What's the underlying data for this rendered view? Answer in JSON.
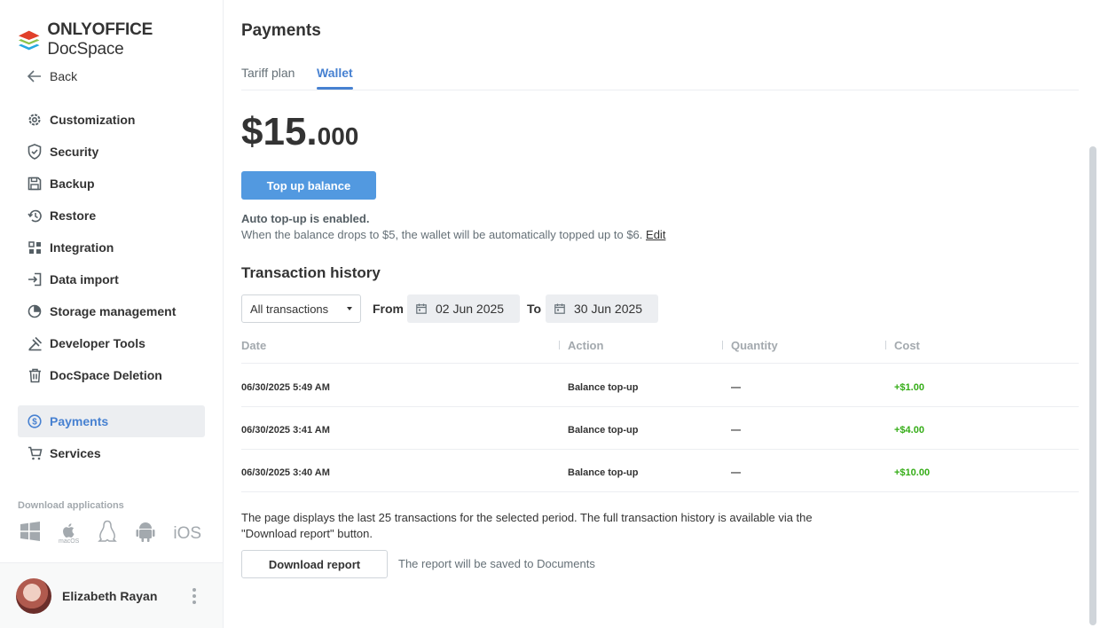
{
  "app": {
    "logo_brand": "ONLYOFFICE",
    "logo_product": "DocSpace"
  },
  "sidebar": {
    "back_label": "Back",
    "items": [
      {
        "label": "Customization",
        "icon": "gear-icon"
      },
      {
        "label": "Security",
        "icon": "shield-icon"
      },
      {
        "label": "Backup",
        "icon": "floppy-icon"
      },
      {
        "label": "Restore",
        "icon": "restore-icon"
      },
      {
        "label": "Integration",
        "icon": "grid-icon"
      },
      {
        "label": "Data import",
        "icon": "import-icon"
      },
      {
        "label": "Storage management",
        "icon": "pie-icon"
      },
      {
        "label": "Developer Tools",
        "icon": "tools-icon"
      },
      {
        "label": "DocSpace Deletion",
        "icon": "trash-icon"
      },
      {
        "label": "Payments",
        "icon": "dollar-icon",
        "active": true
      },
      {
        "label": "Services",
        "icon": "cart-icon"
      }
    ],
    "download_title": "Download applications",
    "download_apps": [
      "windows-icon",
      "macos-icon",
      "linux-icon",
      "android-icon",
      "ios-icon"
    ],
    "macos_label": "macOS",
    "ios_label": "iOS",
    "user_name": "Elizabeth Rayan"
  },
  "main": {
    "title": "Payments",
    "tabs": [
      {
        "label": "Tariff plan"
      },
      {
        "label": "Wallet",
        "active": true
      }
    ],
    "balance_int": "$15.",
    "balance_frac": "000",
    "top_up_label": "Top up balance",
    "auto_title": "Auto top-up is enabled.",
    "auto_desc": "When the balance drops to $5, the wallet will be automatically topped up to $6.",
    "edit_label": "Edit",
    "history_title": "Transaction history",
    "filter_value": "All transactions",
    "from_label": "From",
    "from_date": "02 Jun 2025",
    "to_label": "To",
    "to_date": "30 Jun 2025",
    "columns": [
      "Date",
      "Action",
      "Quantity",
      "Cost"
    ],
    "rows": [
      {
        "date": "06/30/2025 5:49 AM",
        "action": "Balance top-up",
        "quantity": "—",
        "cost": "+$1.00"
      },
      {
        "date": "06/30/2025 3:41 AM",
        "action": "Balance top-up",
        "quantity": "—",
        "cost": "+$4.00"
      },
      {
        "date": "06/30/2025 3:40 AM",
        "action": "Balance top-up",
        "quantity": "—",
        "cost": "+$10.00"
      }
    ],
    "note": "The page displays the last 25 transactions for the selected period. The full transaction history is available via the \"Download report\" button.",
    "download_label": "Download report",
    "report_note": "The report will be saved to Documents"
  },
  "colors": {
    "accent": "#4781d1",
    "button": "#5299e0",
    "positive": "#35ad17"
  }
}
